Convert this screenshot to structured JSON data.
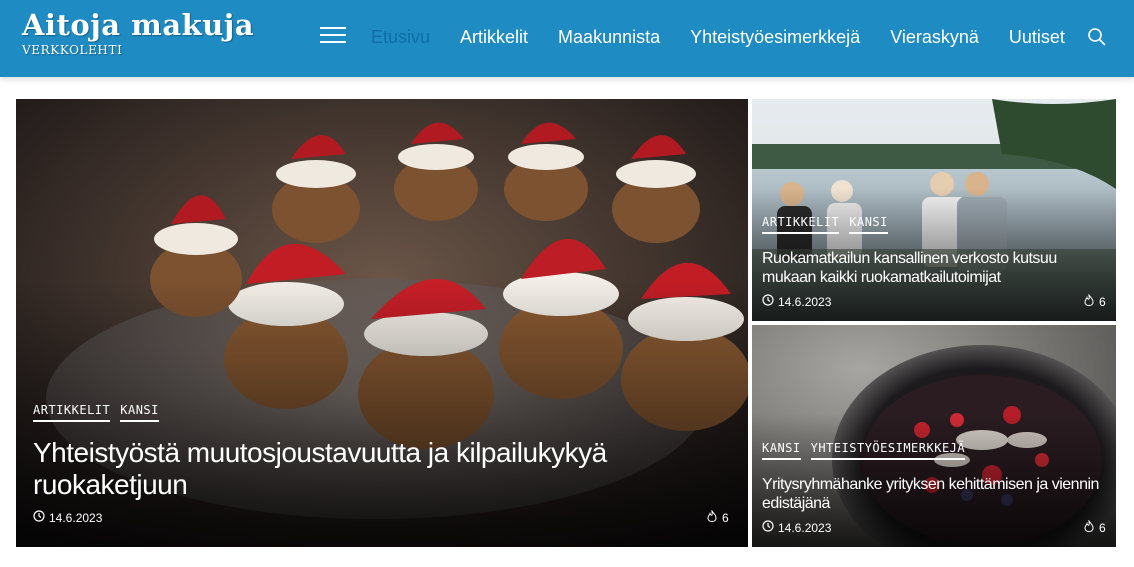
{
  "site": {
    "title": "Aitoja makuja",
    "subtitle": "VERKKOLEHTI"
  },
  "nav": {
    "items": [
      {
        "label": "Etusivu",
        "active": true
      },
      {
        "label": "Artikkelit",
        "active": false
      },
      {
        "label": "Maakunnista",
        "active": false
      },
      {
        "label": "Yhteistyöesimerkkejä",
        "active": false
      },
      {
        "label": "Vieraskynä",
        "active": false
      },
      {
        "label": "Uutiset",
        "active": false
      }
    ]
  },
  "icons": {
    "menu": "hamburger-menu-icon",
    "search": "search-icon",
    "clock": "clock-icon",
    "fire": "fire-icon"
  },
  "colors": {
    "header": "#1e8bc3",
    "active_nav": "#0f6ea5"
  },
  "featured": {
    "tags": [
      "ARTIKKELIT",
      "KANSI"
    ],
    "title": "Yhteistyöstä muutosjoustavuutta ja kilpailukykyä ruokaketjuun",
    "date": "14.6.2023",
    "likes": "6"
  },
  "side_top": {
    "tags": [
      "ARTIKKELIT",
      "KANSI"
    ],
    "title": "Ruokamatkailun kansallinen verkosto kutsuu mukaan kaikki ruokamatkailutoimijat",
    "date": "14.6.2023",
    "likes": "6"
  },
  "side_bottom": {
    "tags": [
      "KANSI",
      "YHTEISTYÖESIMERKKEJÄ"
    ],
    "title": "Yritysryhmähanke yrityksen kehittämisen ja viennin edistäjänä",
    "date": "14.6.2023",
    "likes": "6"
  }
}
